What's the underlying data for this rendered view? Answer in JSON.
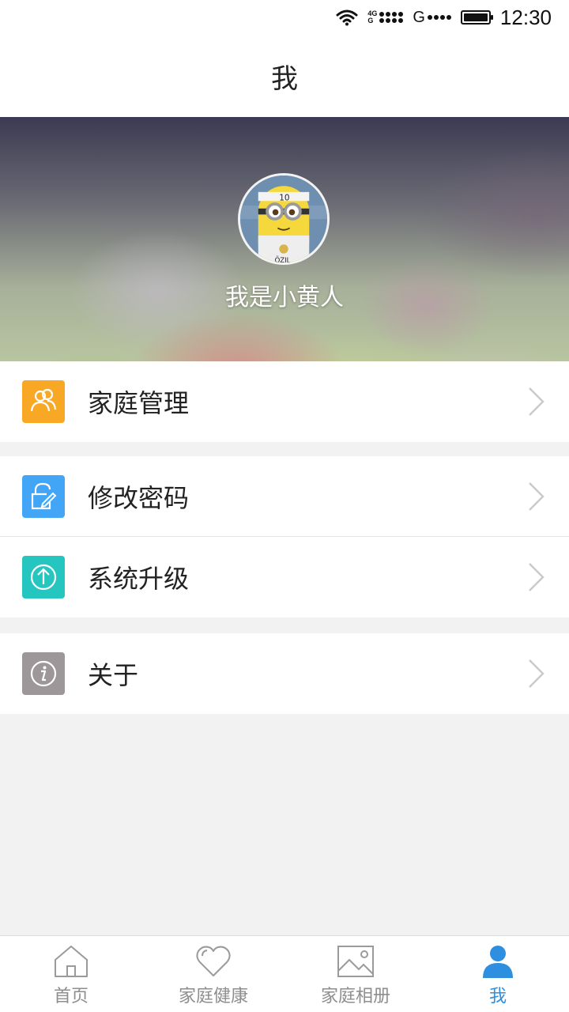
{
  "status_bar": {
    "network_top": "4G",
    "network_bottom": "G",
    "carrier2": "G",
    "time": "12:30"
  },
  "nav": {
    "title": "我"
  },
  "profile": {
    "username": "我是小黄人"
  },
  "menu_groups": [
    [
      {
        "label": "家庭管理",
        "icon": "family-icon",
        "color": "#f9a825"
      }
    ],
    [
      {
        "label": "修改密码",
        "icon": "lock-edit-icon",
        "color": "#42a5f5"
      },
      {
        "label": "系统升级",
        "icon": "upgrade-icon",
        "color": "#26c6c0"
      }
    ],
    [
      {
        "label": "关于",
        "icon": "info-icon",
        "color": "#9e9799"
      }
    ]
  ],
  "tabs": [
    {
      "label": "首页",
      "icon": "home-icon",
      "active": false
    },
    {
      "label": "家庭健康",
      "icon": "heart-icon",
      "active": false
    },
    {
      "label": "家庭相册",
      "icon": "photo-icon",
      "active": false
    },
    {
      "label": "我",
      "icon": "person-icon",
      "active": true
    }
  ],
  "colors": {
    "accent": "#2e8ee0",
    "inactive": "#8e8e8e",
    "background": "#f2f2f2"
  }
}
